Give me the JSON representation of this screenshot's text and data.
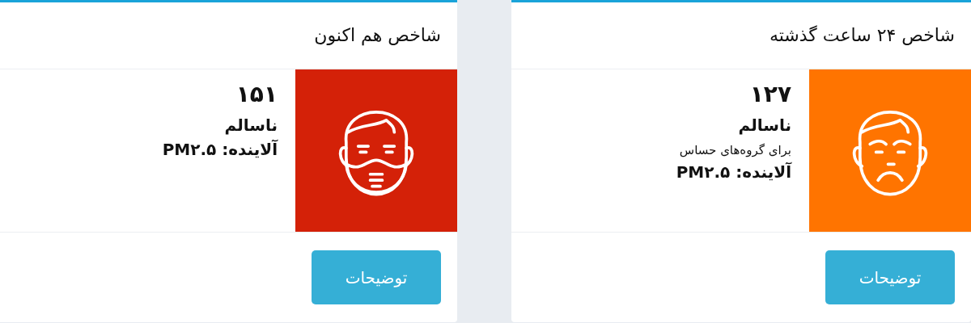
{
  "cards": [
    {
      "title": "شاخص ۲۴ ساعت گذشته",
      "value": "۱۲۷",
      "status": "ناسالم",
      "note": "برای گروه‌های حساس",
      "pollutant": "آلاینده: PM۲.۵",
      "color": "#ff7400",
      "kind": "face",
      "button": "توضیحات"
    },
    {
      "title": "شاخص هم اکنون",
      "value": "۱۵۱",
      "status": "ناسالم",
      "pollutant": "آلاینده: PM۲.۵",
      "color": "#d42108",
      "kind": "mask",
      "button": "توضیحات"
    }
  ]
}
